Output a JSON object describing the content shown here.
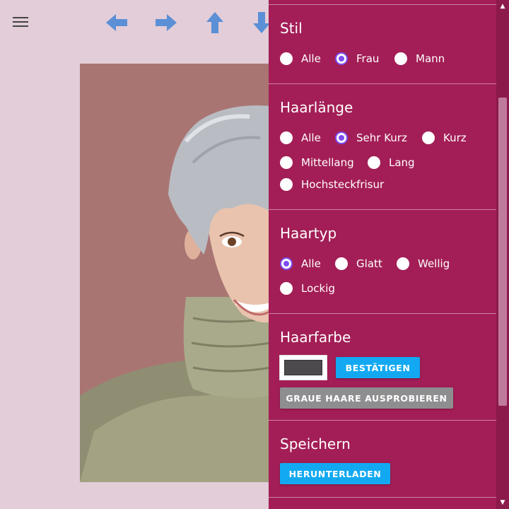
{
  "colors": {
    "page_bg": "#e2cdd8",
    "panel_bg": "#a31e56",
    "accent_radio": "#7b4df0",
    "button_blue": "#12a9f2",
    "button_grey": "#8e8e90",
    "arrow_blue": "#5b8fd6",
    "selected_hair_color": "#4d4a4d"
  },
  "toolbar": {
    "menu_icon": "hamburger-menu-icon",
    "arrows": [
      "arrow-left-icon",
      "arrow-right-icon",
      "arrow-up-icon",
      "arrow-down-icon"
    ]
  },
  "stil": {
    "title": "Stil",
    "options": [
      "Alle",
      "Frau",
      "Mann"
    ],
    "selected": "Frau"
  },
  "haarlaenge": {
    "title": "Haarlänge",
    "options": [
      "Alle",
      "Sehr Kurz",
      "Kurz",
      "Mittellang",
      "Lang",
      "Hochsteckfrisur"
    ],
    "selected": "Sehr Kurz"
  },
  "haartyp": {
    "title": "Haartyp",
    "options": [
      "Alle",
      "Glatt",
      "Wellig",
      "Lockig"
    ],
    "selected": "Alle"
  },
  "haarfarbe": {
    "title": "Haarfarbe",
    "confirm_label": "BESTÄTIGEN",
    "grey_label": "GRAUE HAARE AUSPROBIEREN"
  },
  "speichern": {
    "title": "Speichern",
    "download_label": "HERUNTERLADEN"
  }
}
